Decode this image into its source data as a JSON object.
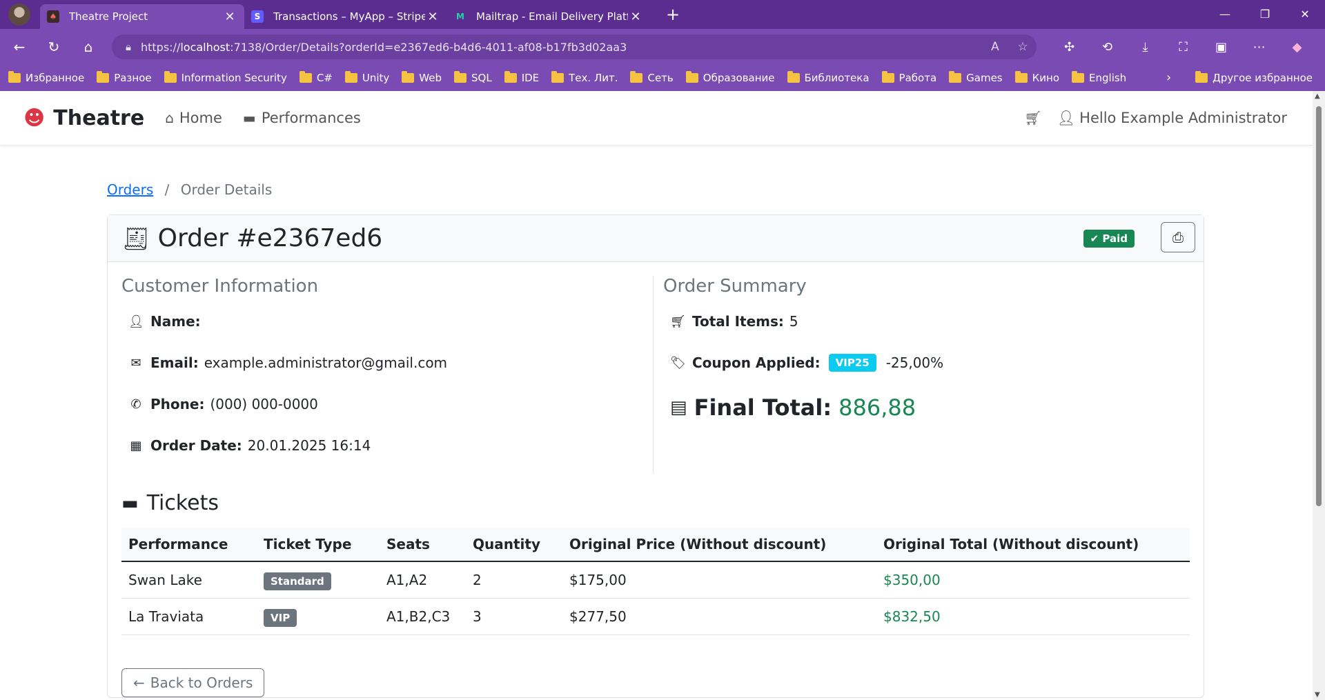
{
  "browser": {
    "tabs": [
      {
        "title": "Theatre Project",
        "active": true
      },
      {
        "title": "Transactions – MyApp – Stripe [Te",
        "active": false
      },
      {
        "title": "Mailtrap - Email Delivery Platform",
        "active": false
      }
    ],
    "url_prefix": "https://",
    "url_host": "localhost",
    "url_rest": ":7138/Order/Details?orderId=e2367ed6-b4d6-4011-af08-b17fb3d02aa3",
    "bookmarks": [
      "Избранное",
      "Разное",
      "Information Security",
      "C#",
      "Unity",
      "Web",
      "SQL",
      "IDE",
      "Тех. Лит.",
      "Сеть",
      "Образование",
      "Библиотека",
      "Работа",
      "Games",
      "Кино",
      "English"
    ],
    "other_bookmarks": "Другое избранное"
  },
  "site": {
    "brand": "Theatre",
    "nav": {
      "home": "Home",
      "performances": "Performances"
    },
    "greeting": "Hello Example Administrator"
  },
  "breadcrumb": {
    "link": "Orders",
    "sep": "/",
    "current": "Order Details"
  },
  "order": {
    "title": "Order #e2367ed6",
    "status": "Paid",
    "customer": {
      "heading": "Customer Information",
      "name_label": "Name:",
      "name": "",
      "email_label": "Email:",
      "email": "example.administrator@gmail.com",
      "phone_label": "Phone:",
      "phone": "(000) 000-0000",
      "date_label": "Order Date:",
      "date": "20.01.2025 16:14"
    },
    "summary": {
      "heading": "Order Summary",
      "items_label": "Total Items:",
      "items": "5",
      "coupon_label": "Coupon Applied:",
      "coupon": "VIP25",
      "discount": "-25,00%",
      "final_label": "Final Total:",
      "final": "886,88"
    }
  },
  "tickets": {
    "heading": "Tickets",
    "columns": [
      "Performance",
      "Ticket Type",
      "Seats",
      "Quantity",
      "Original Price (Without discount)",
      "Original Total (Without discount)"
    ],
    "rows": [
      {
        "performance": "Swan Lake",
        "type": "Standard",
        "seats": "A1,A2",
        "qty": "2",
        "price": "$175,00",
        "total": "$350,00"
      },
      {
        "performance": "La Traviata",
        "type": "VIP",
        "seats": "A1,B2,C3",
        "qty": "3",
        "price": "$277,50",
        "total": "$832,50"
      }
    ]
  },
  "back_label": "Back to Orders",
  "colors": {
    "chrome": "#5b2d91",
    "success": "#198754",
    "info": "#0dcaf0",
    "secondary": "#6c757d",
    "brand": "#dc3545"
  }
}
